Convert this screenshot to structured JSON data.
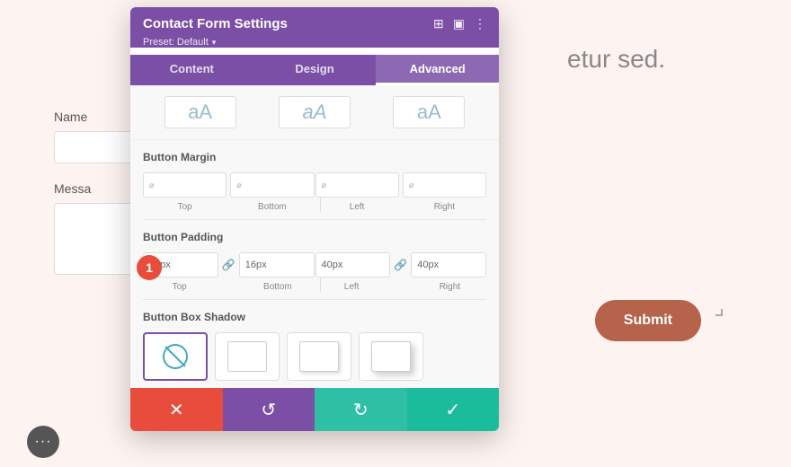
{
  "background": {
    "text": "etur sed.",
    "name_label": "Name",
    "message_label": "Messa",
    "submit_label": "Submit"
  },
  "panel": {
    "title": "Contact Form Settings",
    "preset_label": "Preset: Default",
    "header_icons": [
      "resize-icon",
      "split-icon",
      "more-icon"
    ],
    "tabs": [
      {
        "label": "Content",
        "active": false
      },
      {
        "label": "Design",
        "active": false
      },
      {
        "label": "Advanced",
        "active": true
      }
    ],
    "font_options": [
      "aA",
      "aA",
      "aA"
    ],
    "sections": {
      "button_margin": {
        "title": "Button Margin",
        "fields": [
          {
            "value": "",
            "label": "Top"
          },
          {
            "value": "",
            "label": "Bottom"
          },
          {
            "value": "",
            "label": "Left"
          },
          {
            "value": "",
            "label": "Right"
          }
        ]
      },
      "button_padding": {
        "title": "Button Padding",
        "fields": [
          {
            "value": "16px",
            "label": "Top",
            "linked": true
          },
          {
            "value": "16px",
            "label": "Bottom"
          },
          {
            "value": "40px",
            "label": "Left",
            "linked": true
          },
          {
            "value": "40px",
            "label": "Right"
          }
        ]
      },
      "button_box_shadow": {
        "title": "Button Box Shadow",
        "options": [
          "none",
          "shadow1",
          "shadow2",
          "shadow3"
        ]
      }
    },
    "footer": {
      "cancel_label": "✕",
      "reset_label": "↺",
      "redo_label": "↻",
      "save_label": "✓"
    }
  },
  "badge": {
    "value": "1"
  }
}
